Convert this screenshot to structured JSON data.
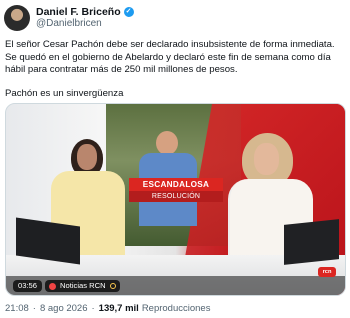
{
  "tweet": {
    "author_name": "Daniel F. Briceño",
    "author_handle": "@Danielbricen",
    "body_paragraph_1": "El señor Cesar Pachón debe ser declarado insubsistente de forma inmediata. Se quedó en el gobierno de Abelardo y declaró este fin de semana como día hábil para contratar más de 250 mil millones de pesos.",
    "body_paragraph_2": "Pachón es un sinvergüenza",
    "timestamp": "21:08",
    "date": "8 ago 2026",
    "views_count": "139,7 mil",
    "views_label": "Reproducciones"
  },
  "media": {
    "headline_main": "ESCANDALOSA",
    "headline_sub": "RESOLUCIÓN",
    "video_time": "03:56",
    "show_label": "Noticias RCN",
    "channel_logo": "rcn"
  },
  "icons": {
    "verified": "verified-badge-icon",
    "live": "live-dot-icon",
    "clock": "clock-icon"
  },
  "colors": {
    "accent": "#1d9bf0",
    "headline_red": "#db2621",
    "text_primary": "#0f1419",
    "text_secondary": "#536471"
  }
}
